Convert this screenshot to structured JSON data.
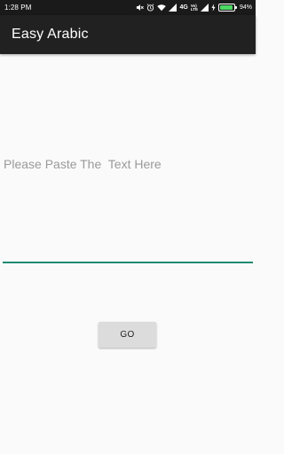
{
  "status_bar": {
    "time": "1:28 PM",
    "network_type": "4G",
    "volte_top": "Vo)",
    "volte_bottom": "LTE",
    "battery_percent": "94%",
    "battery_level": 0.94,
    "battery_color": "#4cd964",
    "icons": [
      "mute-icon",
      "alarm-icon",
      "wifi-icon",
      "signal-icon",
      "signal-icon",
      "charging-icon",
      "battery-icon"
    ]
  },
  "app_bar": {
    "title": "Easy Arabic",
    "background": "#212121"
  },
  "input": {
    "placeholder": "Please Paste The  Text Here",
    "value": "",
    "underline_color": "#1f8a73"
  },
  "go_button": {
    "label": "GO"
  }
}
